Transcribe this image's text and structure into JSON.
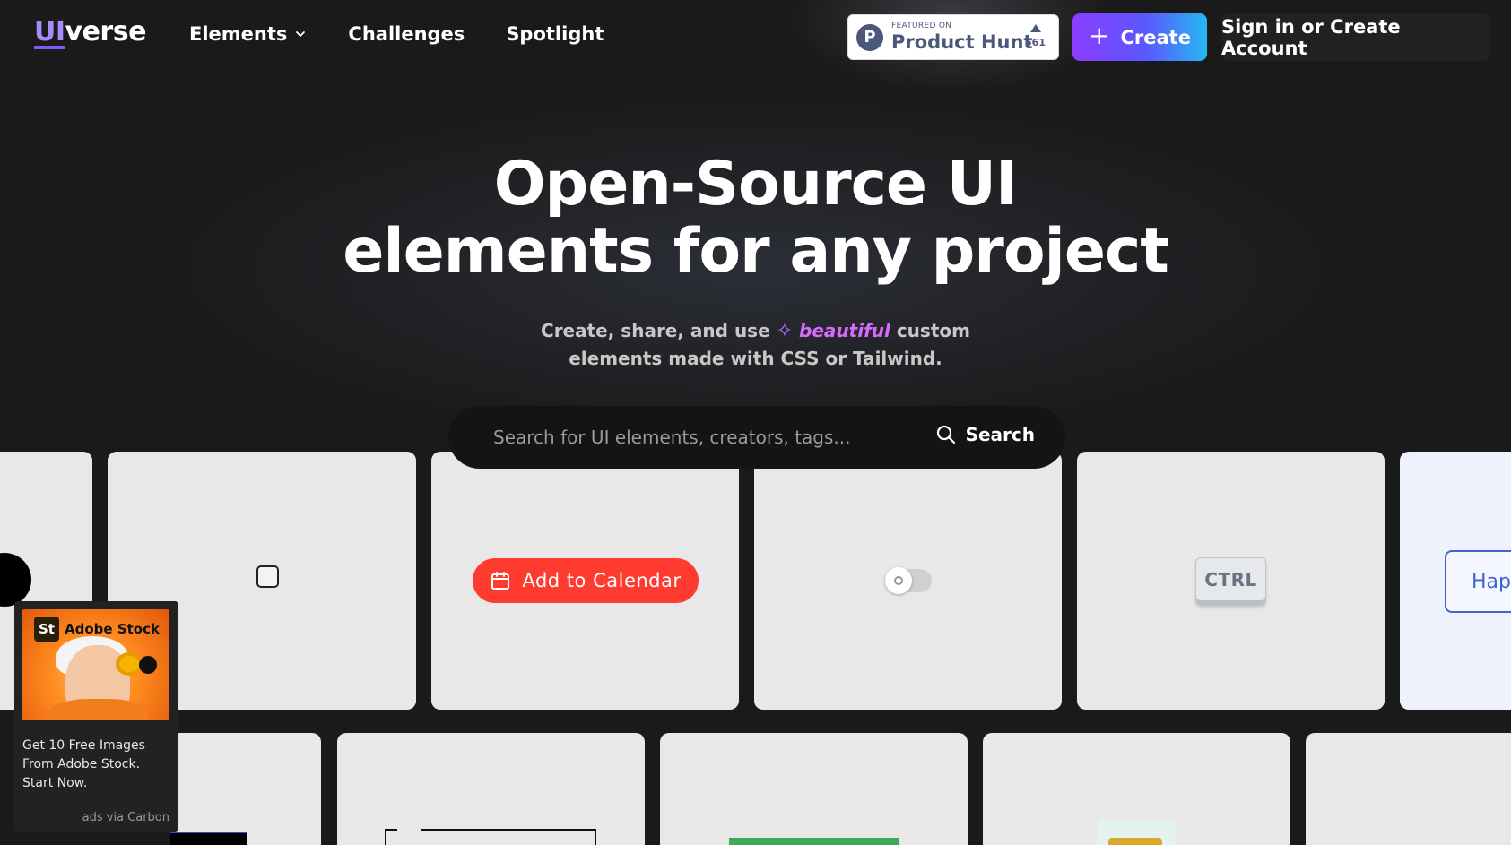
{
  "header": {
    "logo_ui": "UI",
    "logo_verse": "verse",
    "nav": {
      "elements": "Elements",
      "challenges": "Challenges",
      "spotlight": "Spotlight"
    },
    "product_hunt": {
      "featured": "FEATURED ON",
      "name": "Product Hunt",
      "votes": "561",
      "logo_letter": "P"
    },
    "create_label": "Create",
    "signin_label": "Sign in or Create Account"
  },
  "hero": {
    "title_line1": "Open-Source UI",
    "title_line2": "elements for any project",
    "subtitle_before": "Create, share, and use",
    "subtitle_highlight": "beautiful",
    "subtitle_after": "custom",
    "subtitle_line2": "elements made with CSS or Tailwind."
  },
  "search": {
    "placeholder": "Search for UI elements, creators, tags...",
    "button_label": "Search"
  },
  "cards": {
    "calendar_label": "Add to Calendar",
    "kbd_label": "CTRL",
    "hap_label": "Hap"
  },
  "ad": {
    "brand": "Adobe Stock",
    "brand_mark": "St",
    "text": "Get 10 Free Images From Adobe Stock. Start Now.",
    "via": "ads via Carbon"
  },
  "colors": {
    "background": "#1a1a1a",
    "accent_purple": "#8b3dff",
    "accent_blue": "#25b8f2",
    "highlight_pink": "#d56bff",
    "calendar_red": "#ff3b2f",
    "card_bg": "#e8e8e8"
  },
  "icons": {
    "elements_chevron": "chevron-down-icon",
    "create_plus": "plus-icon",
    "sparkle": "sparkle-icon",
    "search": "search-icon",
    "calendar": "calendar-icon"
  }
}
